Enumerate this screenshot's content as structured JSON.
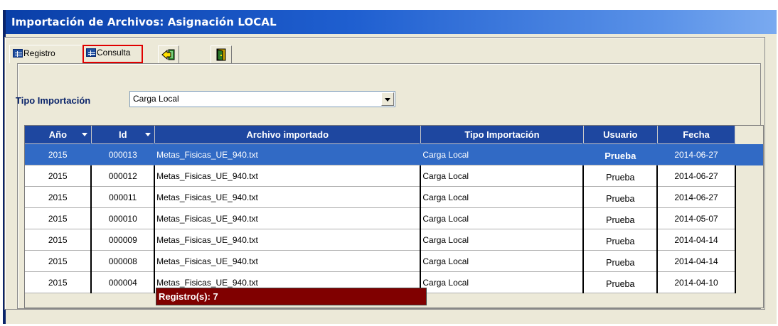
{
  "window": {
    "title": "Importación de Archivos: Asignación LOCAL"
  },
  "tabs": [
    {
      "label": "Registro",
      "icon": "table-icon"
    },
    {
      "label": "Consulta",
      "icon": "table-icon",
      "active": true
    }
  ],
  "toolbar": [
    {
      "icon": "back-arrow-icon"
    },
    {
      "icon": "exit-door-icon"
    }
  ],
  "filter": {
    "label": "Tipo Importación",
    "selected": "Carga Local"
  },
  "table": {
    "columns": [
      "Año",
      "Id",
      "Archivo importado",
      "Tipo Importación",
      "Usuario",
      "Fecha"
    ],
    "rows": [
      {
        "anio": "2015",
        "id": "000013",
        "archivo": "Metas_Fisicas_UE_940.txt",
        "tipo": "Carga Local",
        "usuario": "Prueba",
        "fecha": "2014-06-27"
      },
      {
        "anio": "2015",
        "id": "000012",
        "archivo": "Metas_Fisicas_UE_940.txt",
        "tipo": "Carga Local",
        "usuario": "Prueba",
        "fecha": "2014-06-27"
      },
      {
        "anio": "2015",
        "id": "000011",
        "archivo": "Metas_Fisicas_UE_940.txt",
        "tipo": "Carga Local",
        "usuario": "Prueba",
        "fecha": "2014-06-27"
      },
      {
        "anio": "2015",
        "id": "000010",
        "archivo": "Metas_Fisicas_UE_940.txt",
        "tipo": "Carga Local",
        "usuario": "Prueba",
        "fecha": "2014-05-07"
      },
      {
        "anio": "2015",
        "id": "000009",
        "archivo": "Metas_Fisicas_UE_940.txt",
        "tipo": "Carga Local",
        "usuario": "Prueba",
        "fecha": "2014-04-14"
      },
      {
        "anio": "2015",
        "id": "000008",
        "archivo": "Metas_Fisicas_UE_940.txt",
        "tipo": "Carga Local",
        "usuario": "Prueba",
        "fecha": "2014-04-14"
      },
      {
        "anio": "2015",
        "id": "000004",
        "archivo": "Metas_Fisicas_UE_940.txt",
        "tipo": "Carga Local",
        "usuario": "Prueba",
        "fecha": "2014-04-10"
      }
    ]
  },
  "status": {
    "record_count": "Registro(s): 7"
  },
  "colors": {
    "header_bg": "#1e47a0",
    "selected_row": "#316ac5",
    "status_bg": "#800000",
    "label_color": "#0a246a",
    "active_tab_border": "#e00000"
  }
}
